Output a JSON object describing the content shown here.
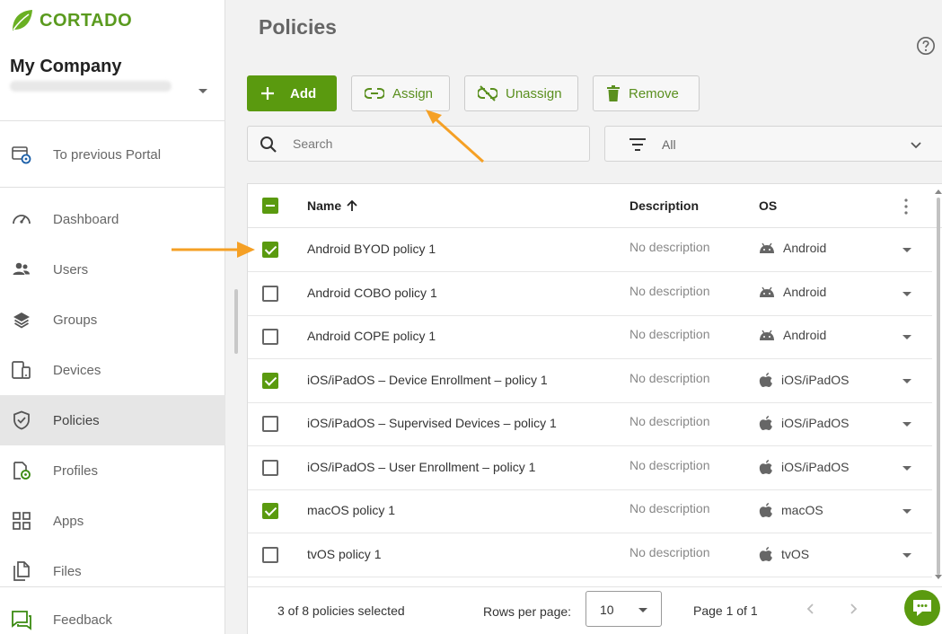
{
  "brand": {
    "name": "CORTADO",
    "color": "#5a9a1e"
  },
  "sidebar": {
    "company": "My Company",
    "back_link": "To previous Portal",
    "items": [
      {
        "label": "Dashboard",
        "icon": "gauge-icon"
      },
      {
        "label": "Users",
        "icon": "users-icon"
      },
      {
        "label": "Groups",
        "icon": "layers-icon"
      },
      {
        "label": "Devices",
        "icon": "devices-icon"
      },
      {
        "label": "Policies",
        "icon": "shield-check-icon",
        "active": true
      },
      {
        "label": "Profiles",
        "icon": "profile-gear-icon"
      },
      {
        "label": "Apps",
        "icon": "apps-grid-icon"
      },
      {
        "label": "Files",
        "icon": "files-icon"
      }
    ],
    "feedback": "Feedback"
  },
  "page": {
    "title": "Policies"
  },
  "toolbar": {
    "add_label": "Add",
    "assign_label": "Assign",
    "unassign_label": "Unassign",
    "remove_label": "Remove"
  },
  "search": {
    "placeholder": "Search",
    "value": ""
  },
  "filter": {
    "value": "All"
  },
  "table": {
    "columns": {
      "name": "Name",
      "description": "Description",
      "os": "OS"
    },
    "rows": [
      {
        "name": "Android BYOD policy 1",
        "description": "No description",
        "os": "Android",
        "os_icon": "android-icon",
        "checked": true
      },
      {
        "name": "Android COBO policy 1",
        "description": "No description",
        "os": "Android",
        "os_icon": "android-icon",
        "checked": false
      },
      {
        "name": "Android COPE policy 1",
        "description": "No description",
        "os": "Android",
        "os_icon": "android-icon",
        "checked": false
      },
      {
        "name": "iOS/iPadOS – Device Enrollment – policy 1",
        "description": "No description",
        "os": "iOS/iPadOS",
        "os_icon": "apple-icon",
        "checked": true
      },
      {
        "name": "iOS/iPadOS – Supervised Devices – policy 1",
        "description": "No description",
        "os": "iOS/iPadOS",
        "os_icon": "apple-icon",
        "checked": false
      },
      {
        "name": "iOS/iPadOS – User Enrollment – policy 1",
        "description": "No description",
        "os": "iOS/iPadOS",
        "os_icon": "apple-icon",
        "checked": false
      },
      {
        "name": "macOS policy 1",
        "description": "No description",
        "os": "macOS",
        "os_icon": "apple-icon",
        "checked": true
      },
      {
        "name": "tvOS policy 1",
        "description": "No description",
        "os": "tvOS",
        "os_icon": "apple-icon",
        "checked": false
      }
    ]
  },
  "footer": {
    "selection": "3 of 8 policies selected",
    "rows_per_page_label": "Rows per page:",
    "rows_per_page": "10",
    "page_info": "Page 1 of 1"
  },
  "colors": {
    "primary": "#5a9a0f",
    "annotation_arrow": "#f5a025"
  }
}
